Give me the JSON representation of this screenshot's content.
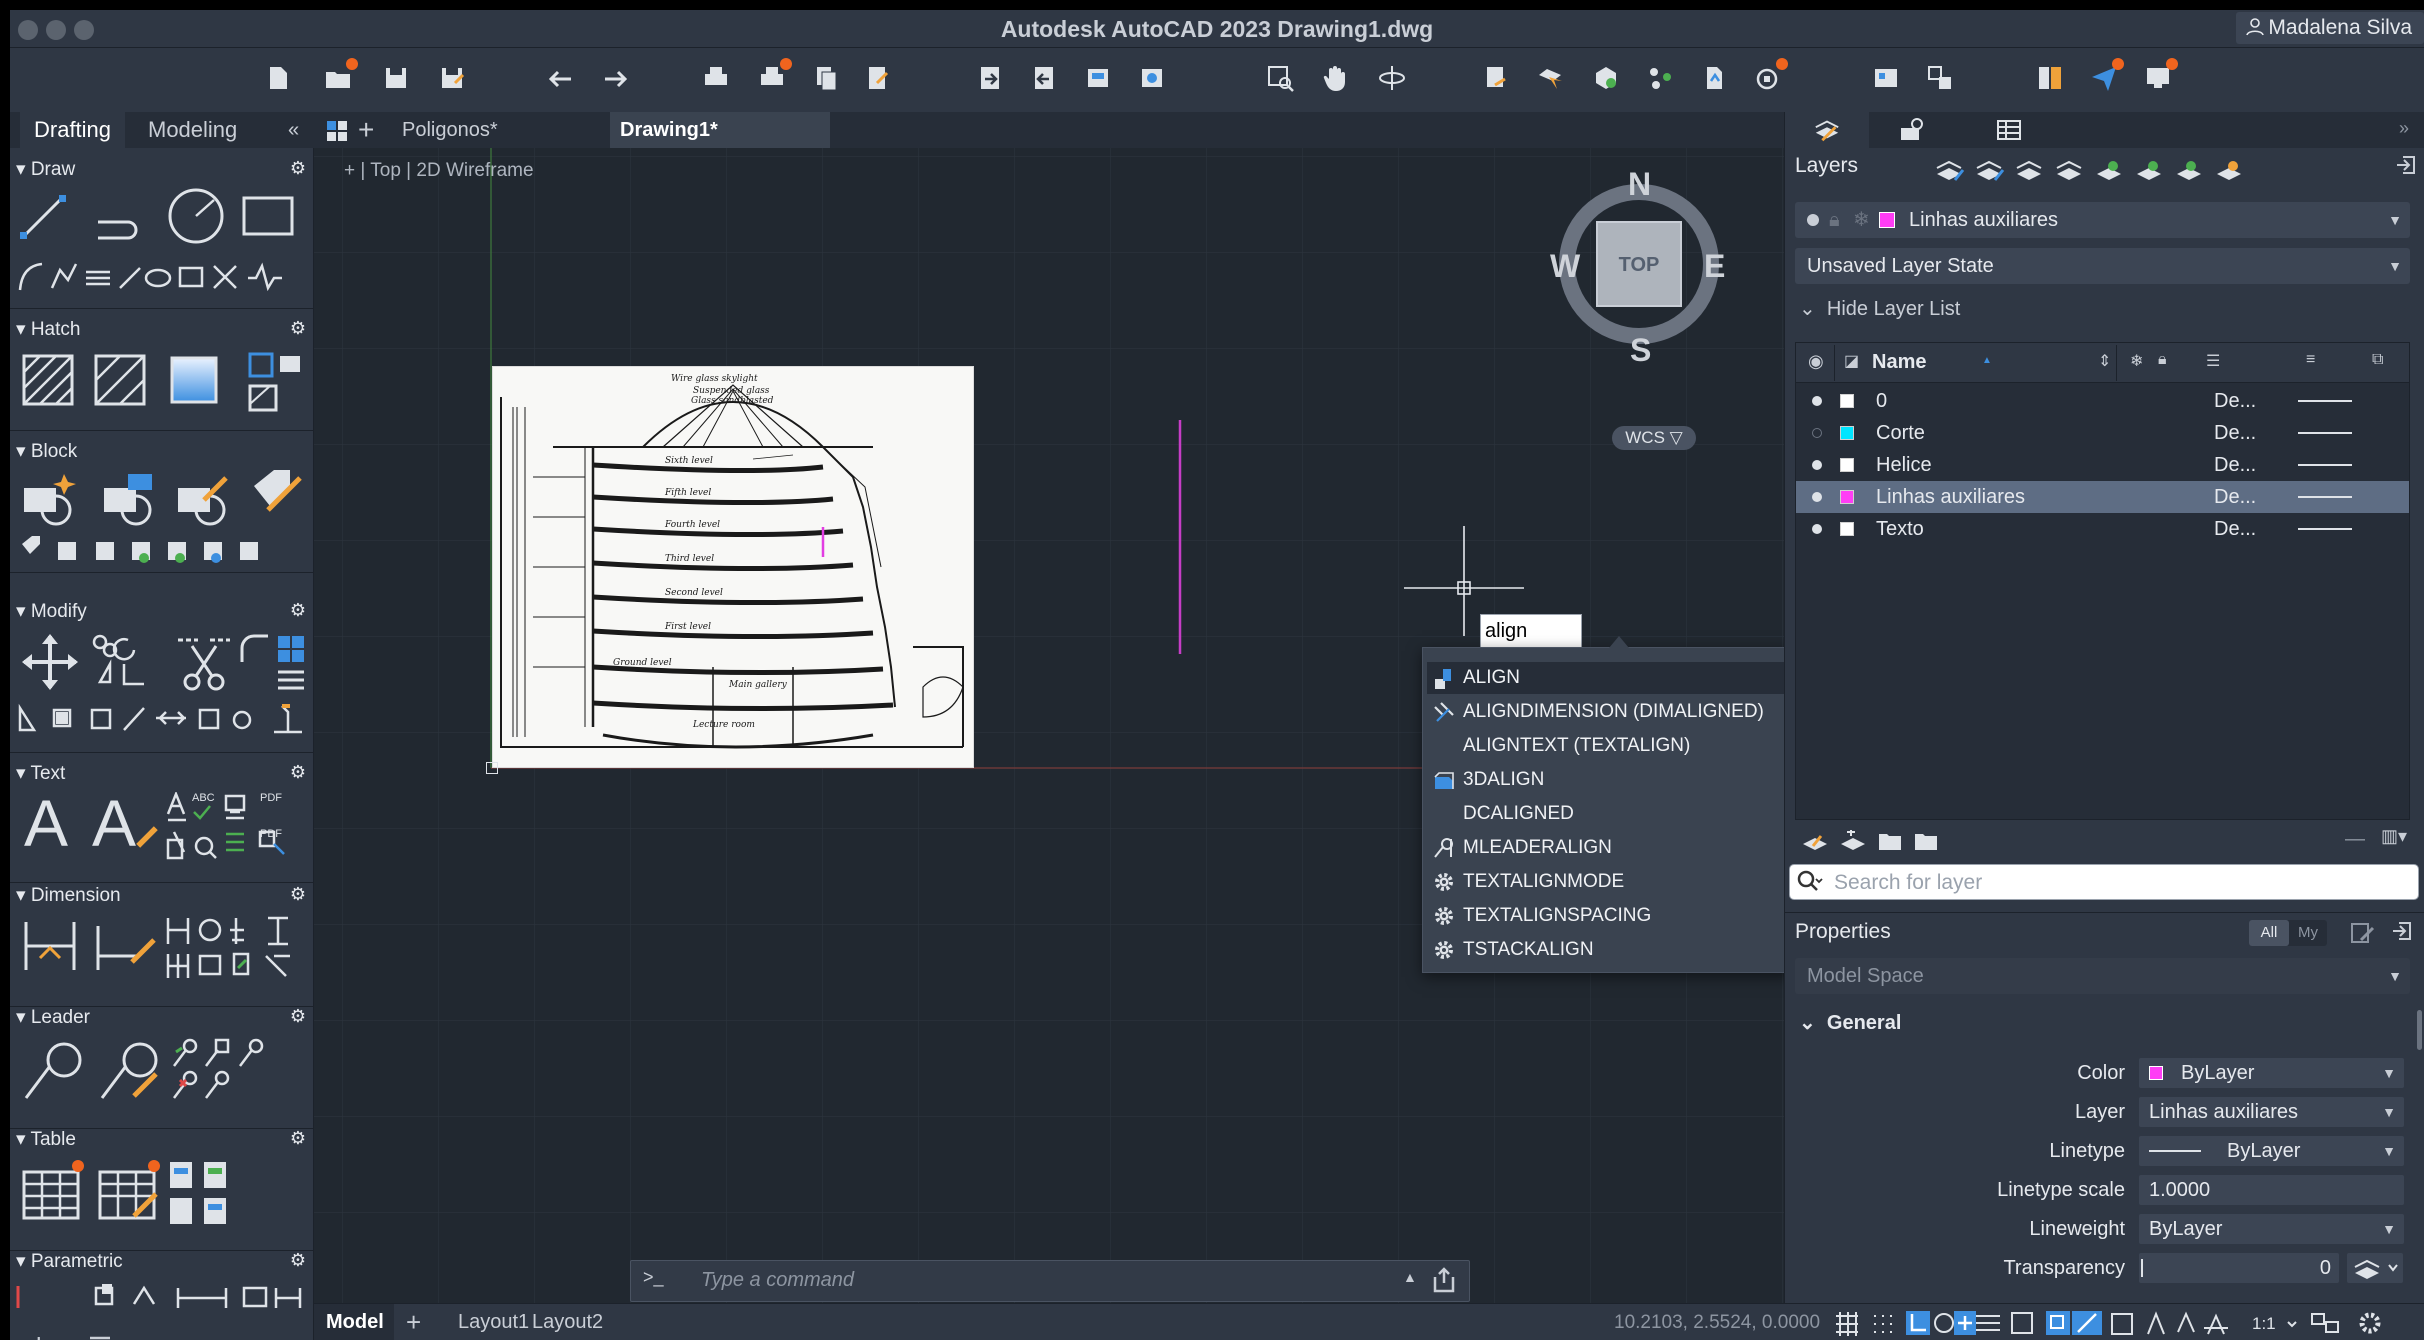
{
  "titlebar": {
    "title": "Autodesk AutoCAD 2023    Drawing1.dwg",
    "user": "Madalena Silva"
  },
  "left_panel": {
    "tabs": [
      "Drafting",
      "Modeling"
    ],
    "collapse_glyph": "«",
    "sections": [
      "Draw",
      "Hatch",
      "Block",
      "Modify",
      "Text",
      "Dimension",
      "Leader",
      "Table",
      "Parametric"
    ],
    "text_large_glyph": "A",
    "text_icon_labels": [
      "ABC",
      "PDF",
      "PDF"
    ]
  },
  "doc_tabs": {
    "tabs": [
      "Poligonos*",
      "Drawing1*"
    ],
    "active": "Drawing1*"
  },
  "viewport": {
    "controls": "+  |  Top  |  2D Wireframe"
  },
  "viewcube": {
    "north": "N",
    "south": "S",
    "east": "E",
    "west": "W",
    "face": "TOP",
    "ucs": "WCS"
  },
  "drawing_labels": [
    "Wire glass skylight",
    "Suspended glass",
    "Glass sandblasted",
    "Sixth level",
    "Fifth level",
    "Fourth level",
    "Third level",
    "Second level",
    "First level",
    "Ground level",
    "Main gallery",
    "Lecture room"
  ],
  "dynamic_input": {
    "value": "align"
  },
  "autocomplete": {
    "items": [
      {
        "label": "ALIGN",
        "icon": "align-icon"
      },
      {
        "label": "ALIGNDIMENSION (DIMALIGNED)",
        "icon": "dimaligned-icon"
      },
      {
        "label": "ALIGNTEXT (TEXTALIGN)",
        "icon": ""
      },
      {
        "label": "3DALIGN",
        "icon": "3dalign-icon"
      },
      {
        "label": "DCALIGNED",
        "icon": ""
      },
      {
        "label": "MLEADERALIGN",
        "icon": "mleaderalign-icon"
      },
      {
        "label": "TEXTALIGNMODE",
        "icon": "gear-icon"
      },
      {
        "label": "TEXTALIGNSPACING",
        "icon": "gear-icon"
      },
      {
        "label": "TSTACKALIGN",
        "icon": "gear-icon"
      }
    ],
    "selected": "ALIGN"
  },
  "command_line": {
    "prompt": ">_",
    "placeholder": "Type a command"
  },
  "statusbar": {
    "tabs": [
      "Model",
      "Layout1",
      "Layout2"
    ],
    "plus": "+",
    "coordinates": "10.2103, 2.5524, 0.0000",
    "scale": "1:1"
  },
  "layers": {
    "title": "Layers",
    "current_layer": "Linhas auxiliares",
    "layer_state": "Unsaved Layer State",
    "hide_list": "Hide Layer List",
    "name_header": "Name",
    "rows": [
      {
        "name": "0",
        "color": "#ffffff",
        "linetype": "De...",
        "on": true
      },
      {
        "name": "Corte",
        "color": "#00e5ff",
        "linetype": "De...",
        "on": false
      },
      {
        "name": "Helice",
        "color": "#ffffff",
        "linetype": "De...",
        "on": true
      },
      {
        "name": "Linhas auxiliares",
        "color": "#ff3df5",
        "linetype": "De...",
        "on": true
      },
      {
        "name": "Texto",
        "color": "#ffffff",
        "linetype": "De...",
        "on": true
      }
    ],
    "selected": "Linhas auxiliares",
    "search_placeholder": "Search for layer"
  },
  "properties": {
    "title": "Properties",
    "filter_all": "All",
    "filter_my": "My",
    "space": "Model Space",
    "group": "General",
    "rows": [
      {
        "label": "Color",
        "value": "ByLayer",
        "swatch": "#ff3df5",
        "dropdown": true
      },
      {
        "label": "Layer",
        "value": "Linhas auxiliares",
        "dropdown": true
      },
      {
        "label": "Linetype",
        "value": "ByLayer",
        "line": true,
        "dropdown": true
      },
      {
        "label": "Linetype scale",
        "value": "1.0000",
        "dropdown": false
      },
      {
        "label": "Lineweight",
        "value": "ByLayer",
        "dropdown": true
      },
      {
        "label": "Transparency",
        "value": "0",
        "dropdown": true
      }
    ]
  },
  "colors": {
    "accent_magenta": "#ff3df5",
    "badge": "#f0641e",
    "highlight_blue": "#3d8fe0"
  }
}
